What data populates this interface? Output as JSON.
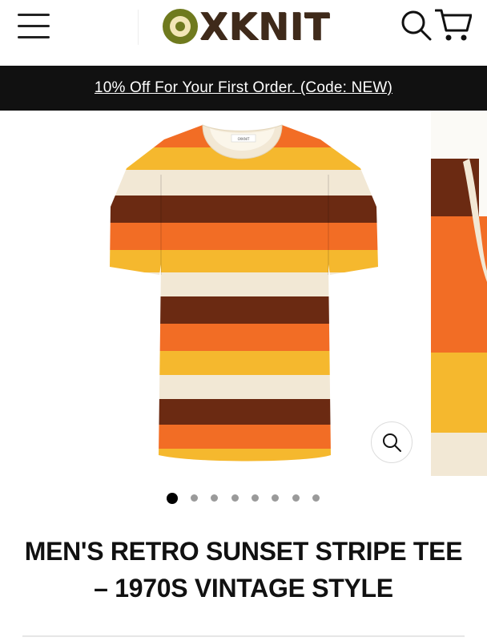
{
  "header": {
    "logo_text": "XKNIT",
    "logo_full": "OXKNIT",
    "menu_icon": "hamburger-menu-icon",
    "search_icon": "search-icon",
    "cart_icon": "cart-icon"
  },
  "announcement": {
    "text": "10% Off For Your First Order. (Code: NEW)"
  },
  "gallery": {
    "product_image": "striped-tshirt",
    "neck_tag": "OXKNIT",
    "zoom_icon": "zoom-icon",
    "slide_count": 8,
    "active_slide": 1,
    "stripe_colors": {
      "cream": "#f2e8d5",
      "orange": "#f26d25",
      "yellow": "#f5b82e",
      "brown": "#6b2a12"
    }
  },
  "product": {
    "title": "MEN'S RETRO SUNSET STRIPE TEE – 1970S VINTAGE STYLE"
  },
  "colors": {
    "announcement_bg": "#111111",
    "logo_olive": "#6f7a1e",
    "logo_brown": "#3f2a1a"
  }
}
